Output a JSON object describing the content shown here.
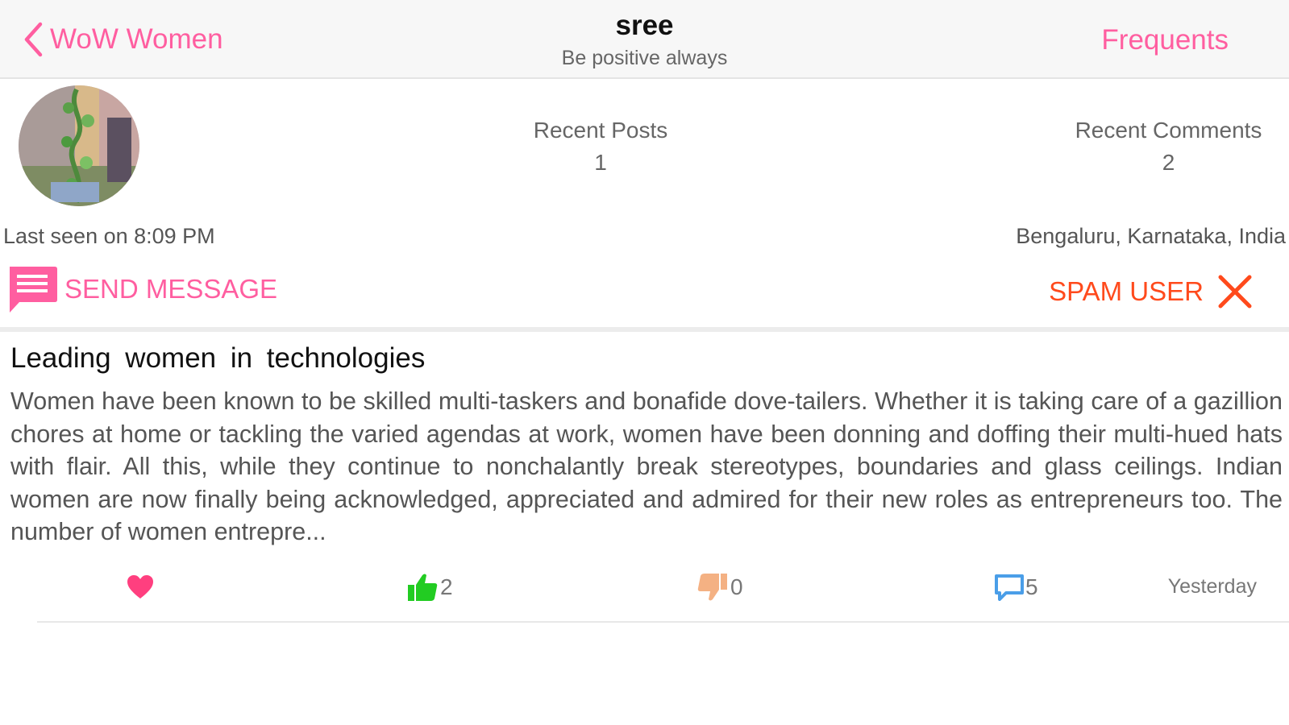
{
  "navbar": {
    "back_label": "WoW Women",
    "title": "sree",
    "subtitle": "Be positive always",
    "right_label": "Frequents"
  },
  "profile": {
    "recent_posts_label": "Recent Posts",
    "recent_posts_count": "1",
    "recent_comments_label": "Recent Comments",
    "recent_comments_count": "2",
    "last_seen": "Last seen on 8:09 PM",
    "location": "Bengaluru, Karnataka, India"
  },
  "actions": {
    "send_message": "SEND MESSAGE",
    "spam_user": "SPAM USER"
  },
  "post": {
    "title": "Leading women in technologies",
    "body": "Women have been known to be skilled multi-taskers and bonafide dove-tailers. Whether it is taking care of a gazillion chores at home or tackling the varied agendas at work, women have been donning and doffing their multi-hued hats with flair. All this, while they continue to nonchalantly break stereotypes, boundaries and glass ceilings. Indian women are now finally being acknowledged, appreciated and admired for their new roles as entrepreneurs too. The number of women entrepre...",
    "likes": "2",
    "dislikes": "0",
    "comments": "5",
    "time": "Yesterday"
  },
  "colors": {
    "accent": "#ff5ea0",
    "spam": "#ff4a1c",
    "like": "#22cc22",
    "dislike": "#f4b183",
    "comment": "#4a9ee8",
    "heart": "#ff3f7f"
  },
  "icons": {
    "back": "chevron-left-icon",
    "send_message": "message-icon",
    "spam": "close-icon",
    "favorite": "heart-icon",
    "like": "thumbs-up-icon",
    "dislike": "thumbs-down-icon",
    "comments": "comment-icon"
  }
}
